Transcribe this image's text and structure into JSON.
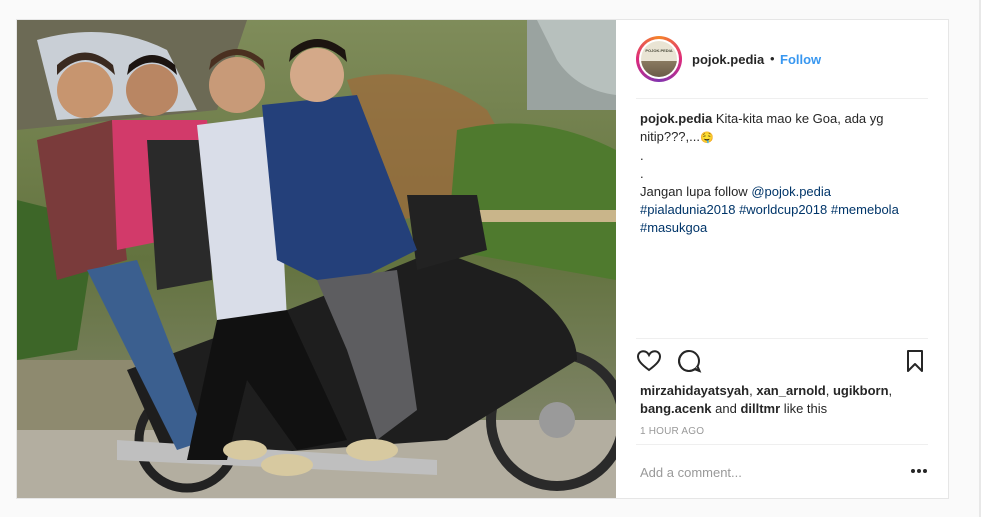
{
  "post": {
    "username": "pojok.pedia",
    "separator": "•",
    "follow_label": "Follow",
    "avatar_text": "POJOK.PEDIA",
    "caption": {
      "username": "pojok.pedia",
      "line1": "Kita-kita mao ke Goa, ada yg nitip???,...",
      "emoji": "🤤",
      "dot1": ".",
      "dot2": ".",
      "line2_prefix": "Jangan lupa follow ",
      "mention": "@pojok.pedia",
      "hashtags": [
        "#pialadunia2018",
        "#worldcup2018",
        "#memebola",
        "#masukgoa"
      ]
    },
    "actions": {
      "like_icon": "heart-icon",
      "comment_icon": "comment-icon",
      "save_icon": "bookmark-icon"
    },
    "likes": {
      "users": [
        "mirzahidayatsyah",
        "xan_arnold",
        "ugikborn",
        "bang.acenk",
        "dilltmr"
      ],
      "sep1": ", ",
      "and": " and ",
      "suffix": " like this"
    },
    "timestamp": "1 HOUR AGO",
    "comment_placeholder": "Add a comment...",
    "more_icon": "more-options-icon"
  },
  "colors": {
    "link": "#003569",
    "follow": "#3897f0",
    "muted": "#999999",
    "text": "#262626"
  }
}
